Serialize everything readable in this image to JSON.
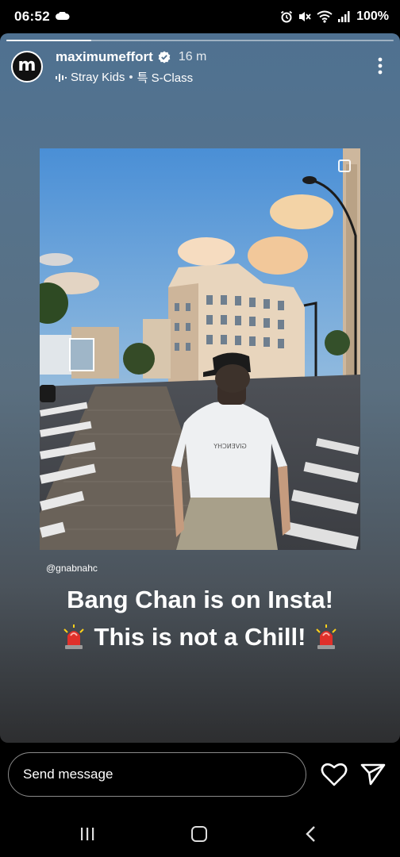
{
  "status_bar": {
    "time": "06:52",
    "battery": "100%",
    "icons": [
      "cloud-icon",
      "alarm-icon",
      "mute-icon",
      "wifi-icon",
      "signal-icon"
    ]
  },
  "story": {
    "progress": 0.22,
    "username": "maximumeffort",
    "avatar_letter": "m",
    "time_ago": "16 m",
    "music_artist": "Stray Kids",
    "music_separator": "•",
    "music_track": "특 S-Class",
    "photo_handle": "@gnabnahc",
    "caption_line1": "Bang Chan is on Insta!",
    "caption_line2": "This is not a Chill!",
    "shirt_text": "GIVENCHY"
  },
  "message_bar": {
    "placeholder": "Send message"
  },
  "colors": {
    "accent": "#ffffff",
    "siren_red": "#e0302a"
  }
}
